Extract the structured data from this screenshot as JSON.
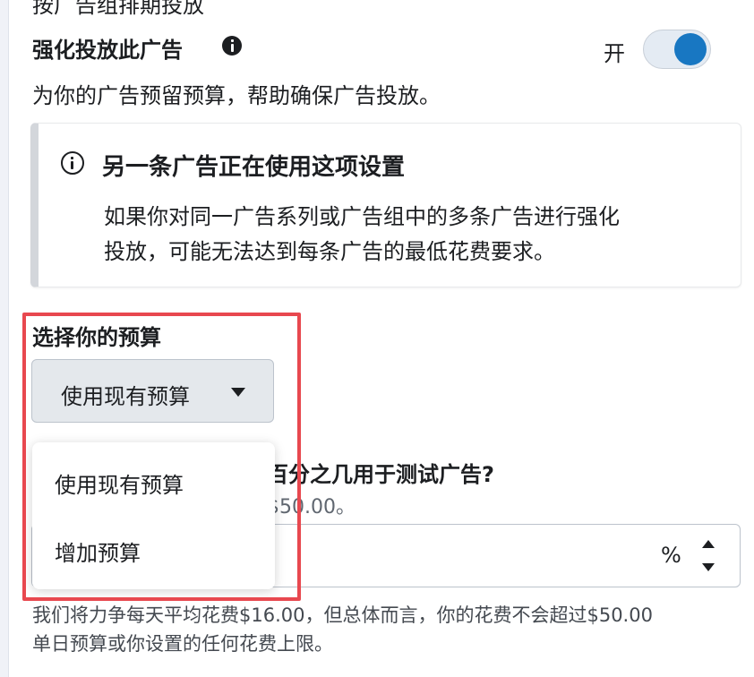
{
  "header": {
    "clipped_title": "按广告组排期投放"
  },
  "boost": {
    "title": "强化投放此广告",
    "toggle_label": "开",
    "toggle_on": true,
    "description": "为你的广告预留预算，帮助确保广告投放。"
  },
  "notice": {
    "title": "另一条广告正在使用这项设置",
    "body_line1": "如果你对同一广告系列或广告组中的多条广告进行强化",
    "body_line2": "投放，可能无法达到每条广告的最低花费要求。"
  },
  "budget": {
    "label": "选择你的预算",
    "selected": "使用现有预算",
    "options": [
      "使用现有预算",
      "增加预算"
    ]
  },
  "percent": {
    "label_visible": "百分之几用于测试广告?",
    "sub_visible": "$50.00。",
    "unit": "%"
  },
  "help": {
    "line1": "我们将力争每天平均花费$16.00，但总体而言，你的花费不会超过$50.00",
    "line2": "单日预算或你设置的任何花费上限。"
  },
  "colors": {
    "accent": "#1877c2",
    "highlight": "#e8484f"
  }
}
